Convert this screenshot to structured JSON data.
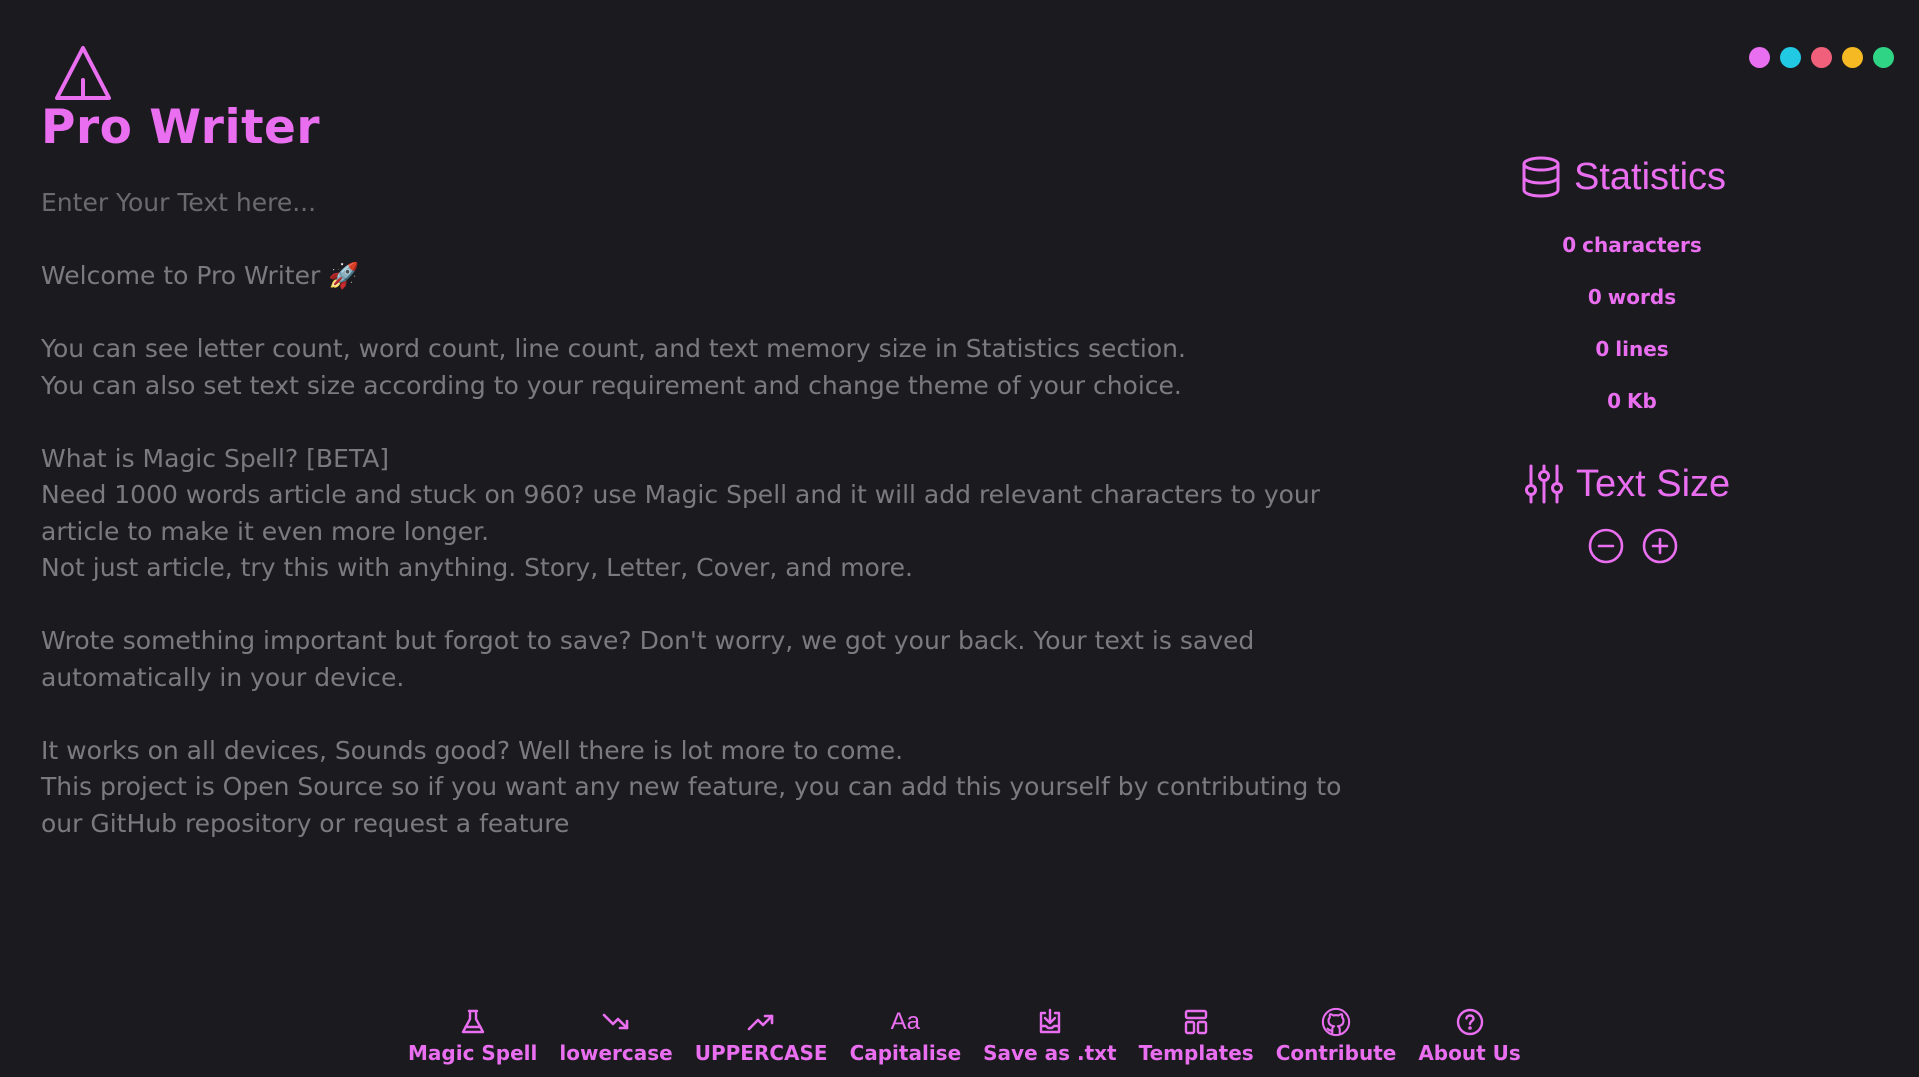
{
  "app": {
    "title": "Pro Writer"
  },
  "theme_colors": [
    "#e86ff0",
    "#22c9e3",
    "#f0607a",
    "#f5b923",
    "#2fd585"
  ],
  "accent_color": "#ea6ff0",
  "editor": {
    "placeholder": "Enter Your Text here...",
    "content": "Welcome to Pro Writer 🚀\n\nYou can see letter count, word count, line count, and text memory size in Statistics section.\nYou can also set text size according to your requirement and change theme of your choice.\n\nWhat is Magic Spell? [BETA]\nNeed 1000 words article and stuck on 960? use Magic Spell and it will add relevant characters to your\narticle to make it even more longer.\nNot just article, try this with anything. Story, Letter, Cover, and more.\n\nWrote something important but forgot to save? Don't worry, we got your back. Your text is saved\nautomatically in your device.\n\nIt works on all devices, Sounds good? Well there is lot more to come.\nThis project is Open Source so if you want any new feature, you can add this yourself by contributing to\nour GitHub repository or request a feature"
  },
  "statistics": {
    "title": "Statistics",
    "icon": "database-icon",
    "items": [
      {
        "value": "0",
        "unit": "characters"
      },
      {
        "value": "0",
        "unit": "words"
      },
      {
        "value": "0",
        "unit": "lines"
      },
      {
        "value": "0",
        "unit": "Kb"
      }
    ]
  },
  "text_size": {
    "title": "Text Size",
    "icon": "sliders-icon",
    "decrease_icon": "minus-circle-icon",
    "increase_icon": "plus-circle-icon"
  },
  "toolbar": [
    {
      "label": "Magic Spell",
      "icon": "flask-icon"
    },
    {
      "label": "lowercase",
      "icon": "trend-down-icon"
    },
    {
      "label": "UPPERCASE",
      "icon": "trend-up-icon"
    },
    {
      "label": "Capitalise",
      "icon": "text-case-icon",
      "glyph": "Aa"
    },
    {
      "label": "Save as .txt",
      "icon": "download-icon"
    },
    {
      "label": "Templates",
      "icon": "layout-icon"
    },
    {
      "label": "Contribute",
      "icon": "github-icon"
    },
    {
      "label": "About Us",
      "icon": "help-circle-icon"
    }
  ]
}
